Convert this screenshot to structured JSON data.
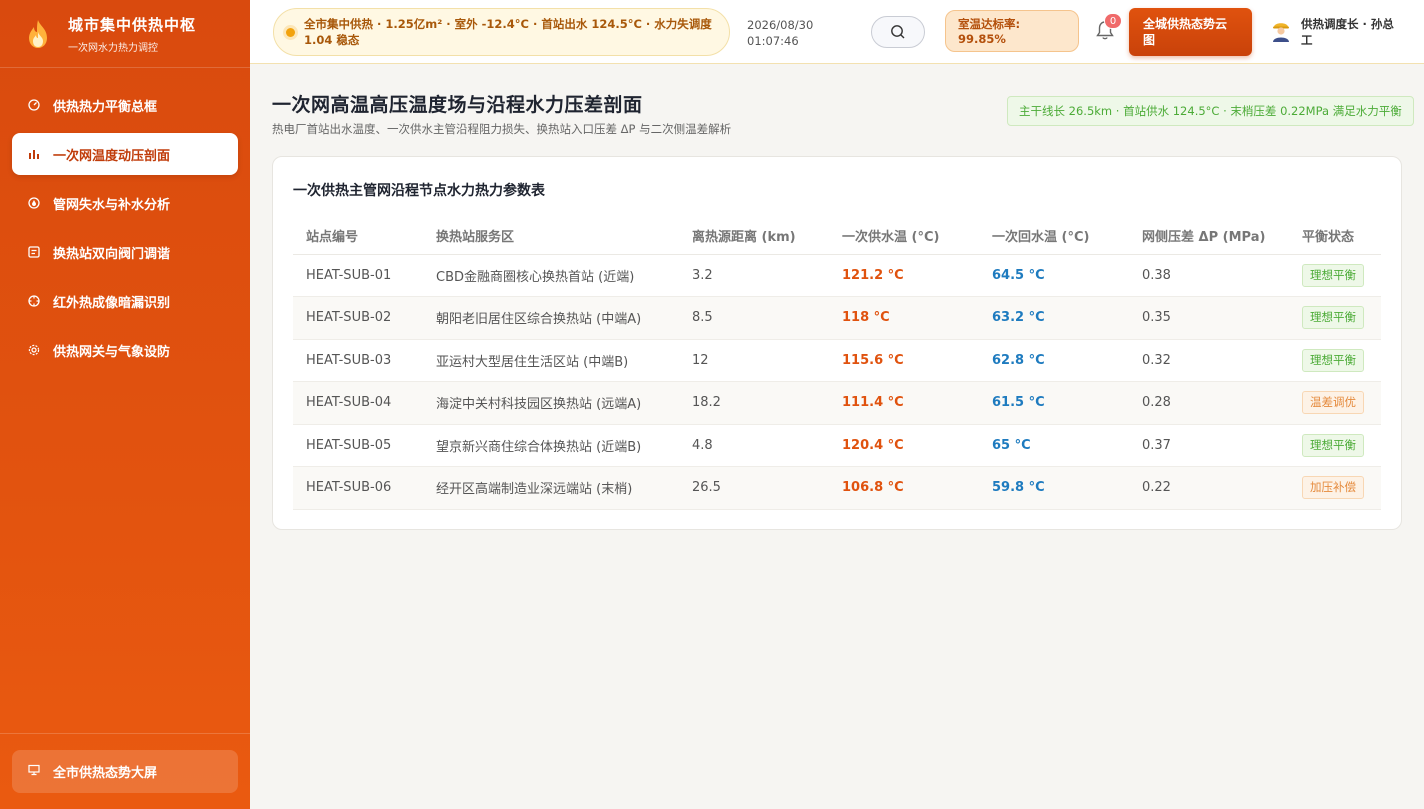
{
  "sidebar": {
    "brand_title": "城市集中供热中枢",
    "brand_sub": "一次网水力热力调控",
    "items": [
      {
        "label": "供热热力平衡总框",
        "icon": "gauge-icon",
        "active": false
      },
      {
        "label": "一次网温度动压剖面",
        "icon": "bar-chart-icon",
        "active": true
      },
      {
        "label": "管网失水与补水分析",
        "icon": "water-drop-icon",
        "active": false
      },
      {
        "label": "换热站双向阀门调谐",
        "icon": "valve-icon",
        "active": false
      },
      {
        "label": "红外热成像暗漏识别",
        "icon": "crosshair-icon",
        "active": false
      },
      {
        "label": "供热网关与气象设防",
        "icon": "gear-icon",
        "active": false
      }
    ],
    "bottom_label": "全市供热态势大屏"
  },
  "header": {
    "ticker": "全市集中供热 · 1.25亿m² · 室外 -12.4°C · 首站出水 124.5°C · 水力失调度 1.04 稳态",
    "date": "2026/08/30",
    "time": "01:07:46",
    "rate_label": "室温达标率:",
    "rate_value": "99.85%",
    "notif_count": "0",
    "cloud_button": "全城供热态势云图",
    "user_name": "供热调度长 · 孙总工"
  },
  "main": {
    "title": "一次网高温高压温度场与沿程水力压差剖面",
    "subtitle": "热电厂首站出水温度、一次供水主管沿程阻力损失、换热站入口压差 ΔP 与二次侧温差解析",
    "summary": "主干线长 26.5km · 首站供水 124.5°C · 末梢压差 0.22MPa 满足水力平衡",
    "card_title": "一次供热主管网沿程节点水力热力参数表",
    "columns": [
      "站点编号",
      "换热站服务区",
      "离热源距离 (km)",
      "一次供水温 (°C)",
      "一次回水温 (°C)",
      "网侧压差 ΔP (MPa)",
      "平衡状态"
    ],
    "rows": [
      {
        "id": "HEAT-SUB-01",
        "area": "CBD金融商圈核心换热首站 (近端)",
        "dist": "3.2",
        "supply": "121.2 °C",
        "ret": "64.5 °C",
        "dp": "0.38",
        "status": "理想平衡",
        "status_type": "ok"
      },
      {
        "id": "HEAT-SUB-02",
        "area": "朝阳老旧居住区综合换热站 (中端A)",
        "dist": "8.5",
        "supply": "118 °C",
        "ret": "63.2 °C",
        "dp": "0.35",
        "status": "理想平衡",
        "status_type": "ok"
      },
      {
        "id": "HEAT-SUB-03",
        "area": "亚运村大型居住生活区站 (中端B)",
        "dist": "12",
        "supply": "115.6 °C",
        "ret": "62.8 °C",
        "dp": "0.32",
        "status": "理想平衡",
        "status_type": "ok"
      },
      {
        "id": "HEAT-SUB-04",
        "area": "海淀中关村科技园区换热站 (远端A)",
        "dist": "18.2",
        "supply": "111.4 °C",
        "ret": "61.5 °C",
        "dp": "0.28",
        "status": "温差调优",
        "status_type": "warn"
      },
      {
        "id": "HEAT-SUB-05",
        "area": "望京新兴商住综合体换热站 (近端B)",
        "dist": "4.8",
        "supply": "120.4 °C",
        "ret": "65 °C",
        "dp": "0.37",
        "status": "理想平衡",
        "status_type": "ok"
      },
      {
        "id": "HEAT-SUB-06",
        "area": "经开区高端制造业深远端站 (末梢)",
        "dist": "26.5",
        "supply": "106.8 °C",
        "ret": "59.8 °C",
        "dp": "0.22",
        "status": "加压补偿",
        "status_type": "warn"
      }
    ]
  },
  "colors": {
    "accent": "#e0520e",
    "supply": "#e0520e",
    "return": "#1e7bbf",
    "ok": "#4cab37",
    "warn": "#e58a3c"
  }
}
